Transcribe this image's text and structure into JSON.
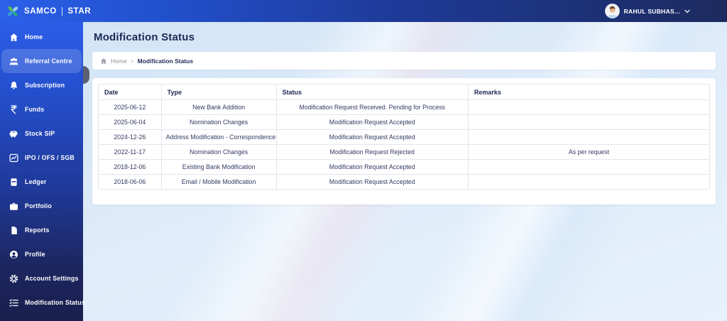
{
  "topbar": {
    "brand": {
      "name": "SAMCO",
      "sub": "STAR"
    },
    "user": {
      "name": "RAHUL SUBHAS..."
    }
  },
  "sidebar": {
    "items": [
      {
        "label": "Home",
        "icon": "home-icon",
        "active": false
      },
      {
        "label": "Referral Centre",
        "icon": "referral-icon",
        "active": true
      },
      {
        "label": "Subscription",
        "icon": "bell-icon",
        "active": false
      },
      {
        "label": "Funds",
        "icon": "rupee-icon",
        "active": false
      },
      {
        "label": "Stock SIP",
        "icon": "piggy-bank-icon",
        "active": false
      },
      {
        "label": "IPO / OFS / SGB",
        "icon": "chart-icon",
        "active": false
      },
      {
        "label": "Ledger",
        "icon": "ledger-icon",
        "active": false
      },
      {
        "label": "Portfolio",
        "icon": "briefcase-icon",
        "active": false
      },
      {
        "label": "Reports",
        "icon": "report-icon",
        "active": false
      },
      {
        "label": "Profile",
        "icon": "profile-icon",
        "active": false
      },
      {
        "label": "Account Settings",
        "icon": "gear-icon",
        "active": false
      },
      {
        "label": "Modification Status",
        "icon": "checklist-icon",
        "active": false
      }
    ]
  },
  "main": {
    "page_title": "Modification Status",
    "breadcrumb": {
      "home": "Home",
      "separator": ">",
      "current": "Modification Status"
    },
    "table": {
      "headers": [
        "Date",
        "Type",
        "Status",
        "Remarks"
      ],
      "rows": [
        {
          "date": "2025-06-12",
          "type": "New Bank Addition",
          "status": "Modification Request Received. Pending for Process",
          "remarks": ""
        },
        {
          "date": "2025-06-04",
          "type": "Nomination Changes",
          "status": "Modification Request Accepted",
          "remarks": ""
        },
        {
          "date": "2024-12-26",
          "type": "Address Modification - Correspondence",
          "status": "Modification Request Accepted",
          "remarks": ""
        },
        {
          "date": "2022-11-17",
          "type": "Nomination Changes",
          "status": "Modification Request Rejected",
          "remarks": "As per request"
        },
        {
          "date": "2018-12-06",
          "type": "Existing Bank Modification",
          "status": "Modification Request Accepted",
          "remarks": ""
        },
        {
          "date": "2018-06-06",
          "type": "Email / Mobile Modification",
          "status": "Modification Request Accepted",
          "remarks": ""
        }
      ]
    }
  },
  "colors": {
    "topbar_left": "#2b60e9",
    "topbar_right": "#1c2a5e",
    "sidebar_top": "#2c5de8",
    "sidebar_bottom": "#191f4d",
    "active_item_highlight": "rgba(255,255,255,0.16)",
    "main_background": "#dce9f7",
    "heading_text": "#1c2a55",
    "table_text": "#333a63",
    "table_border": "#e3e5ec"
  }
}
